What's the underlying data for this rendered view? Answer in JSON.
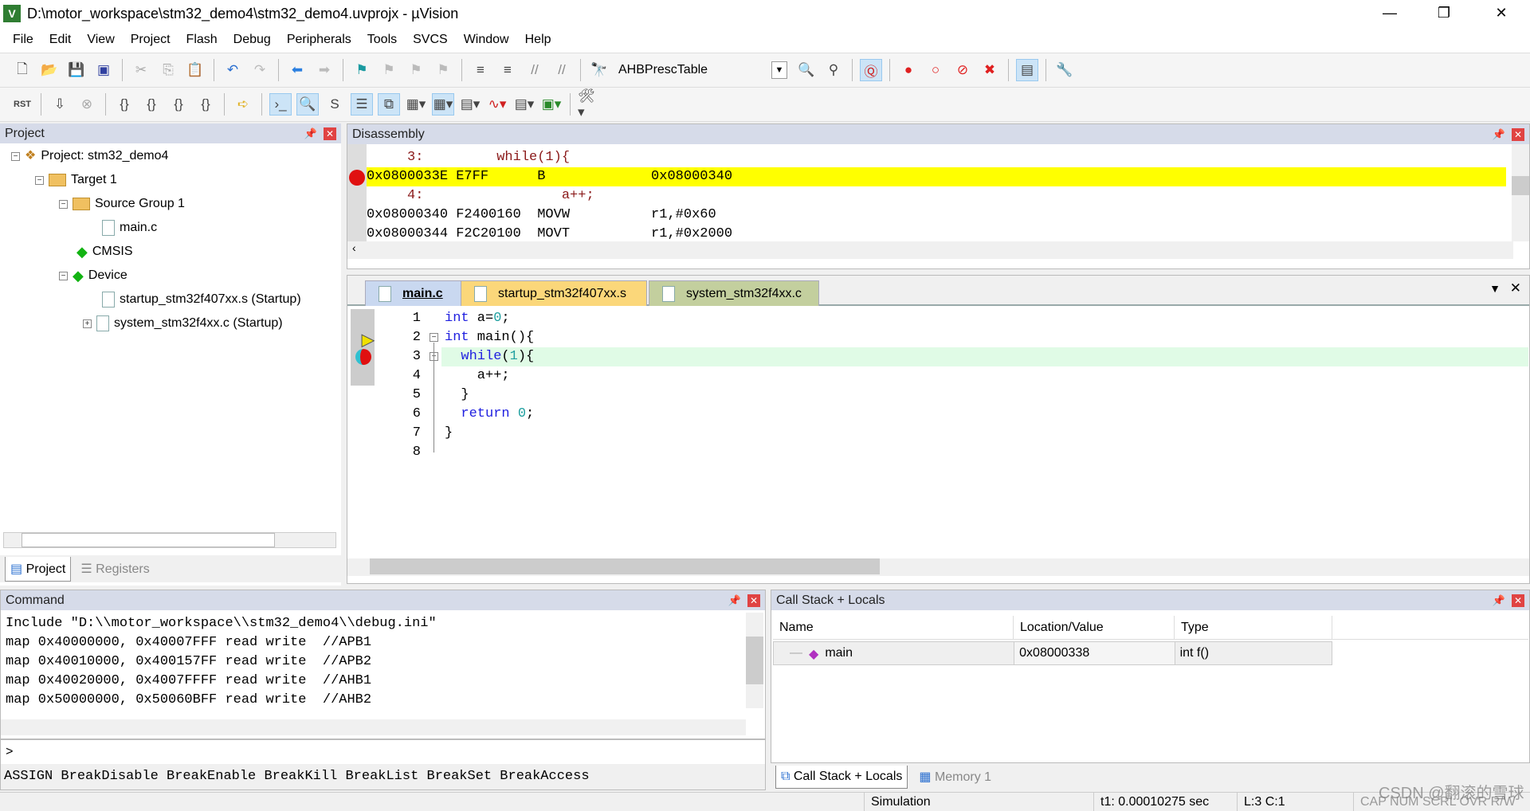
{
  "window": {
    "title": "D:\\motor_workspace\\stm32_demo4\\stm32_demo4.uvprojx - µVision",
    "app_icon": "V",
    "minimize": "—",
    "restore": "❐",
    "close": "✕"
  },
  "menu": [
    "File",
    "Edit",
    "View",
    "Project",
    "Flash",
    "Debug",
    "Peripherals",
    "Tools",
    "SVCS",
    "Window",
    "Help"
  ],
  "toolbar": {
    "find_combo": "AHBPrescTable"
  },
  "project": {
    "title": "Project",
    "tree": [
      "Project: stm32_demo4",
      "Target 1",
      "Source Group 1",
      "main.c",
      "CMSIS",
      "Device",
      "startup_stm32f407xx.s (Startup)",
      "system_stm32f4xx.c (Startup)"
    ],
    "tabs": [
      "Project",
      "Registers"
    ]
  },
  "disassembly": {
    "title": "Disassembly",
    "lines": [
      {
        "kind": "src",
        "text": "     3:         while(1){"
      },
      {
        "kind": "cur",
        "text": "0x0800033E E7FF      B             0x08000340"
      },
      {
        "kind": "src",
        "text": "     4:                 a++;"
      },
      {
        "kind": "asm",
        "text": "0x08000340 F2400160  MOVW          r1,#0x60"
      },
      {
        "kind": "asm",
        "text": "0x08000344 F2C20100  MOVT          r1,#0x2000"
      }
    ]
  },
  "editor": {
    "tabs": [
      "main.c",
      "startup_stm32f407xx.s",
      "system_stm32f4xx.c"
    ],
    "tab_colors": [
      "#c9d8f0",
      "#fbd77a",
      "#c3cf9e"
    ],
    "line_numbers": [
      "1",
      "2",
      "3",
      "4",
      "5",
      "6",
      "7",
      "8"
    ],
    "lines": [
      [
        "int",
        " a=",
        "0",
        ";"
      ],
      [
        "int",
        " main(){",
        "",
        ""
      ],
      [
        "  while",
        "(",
        "1",
        "){"
      ],
      [
        "    a++;",
        "",
        "",
        ""
      ],
      [
        "  }",
        "",
        "",
        ""
      ],
      [
        "  return",
        " ",
        "0",
        ";"
      ],
      [
        "}",
        "",
        "",
        ""
      ],
      [
        "",
        "",
        "",
        ""
      ]
    ]
  },
  "command": {
    "title": "Command",
    "output": [
      "Include \"D:\\\\motor_workspace\\\\stm32_demo4\\\\debug.ini\"",
      "map 0x40000000, 0x40007FFF read write  //APB1",
      "map 0x40010000, 0x400157FF read write  //APB2",
      "map 0x40020000, 0x4007FFFF read write  //AHB1",
      "map 0x50000000, 0x50060BFF read write  //AHB2"
    ],
    "prompt": ">",
    "hint": "ASSIGN BreakDisable BreakEnable BreakKill BreakList BreakSet BreakAccess"
  },
  "callstack": {
    "title": "Call Stack + Locals",
    "columns": [
      "Name",
      "Location/Value",
      "Type"
    ],
    "rows": [
      {
        "name": "main",
        "value": "0x08000338",
        "type": "int f()"
      }
    ],
    "tabs": [
      "Call Stack + Locals",
      "Memory 1"
    ]
  },
  "status": {
    "mode": "Simulation",
    "time": "t1: 0.00010275 sec",
    "pos": "L:3 C:1",
    "flags": "CAP NUM SCRL OVR R/W",
    "watermark": "CSDN @翻滚的雪球"
  }
}
